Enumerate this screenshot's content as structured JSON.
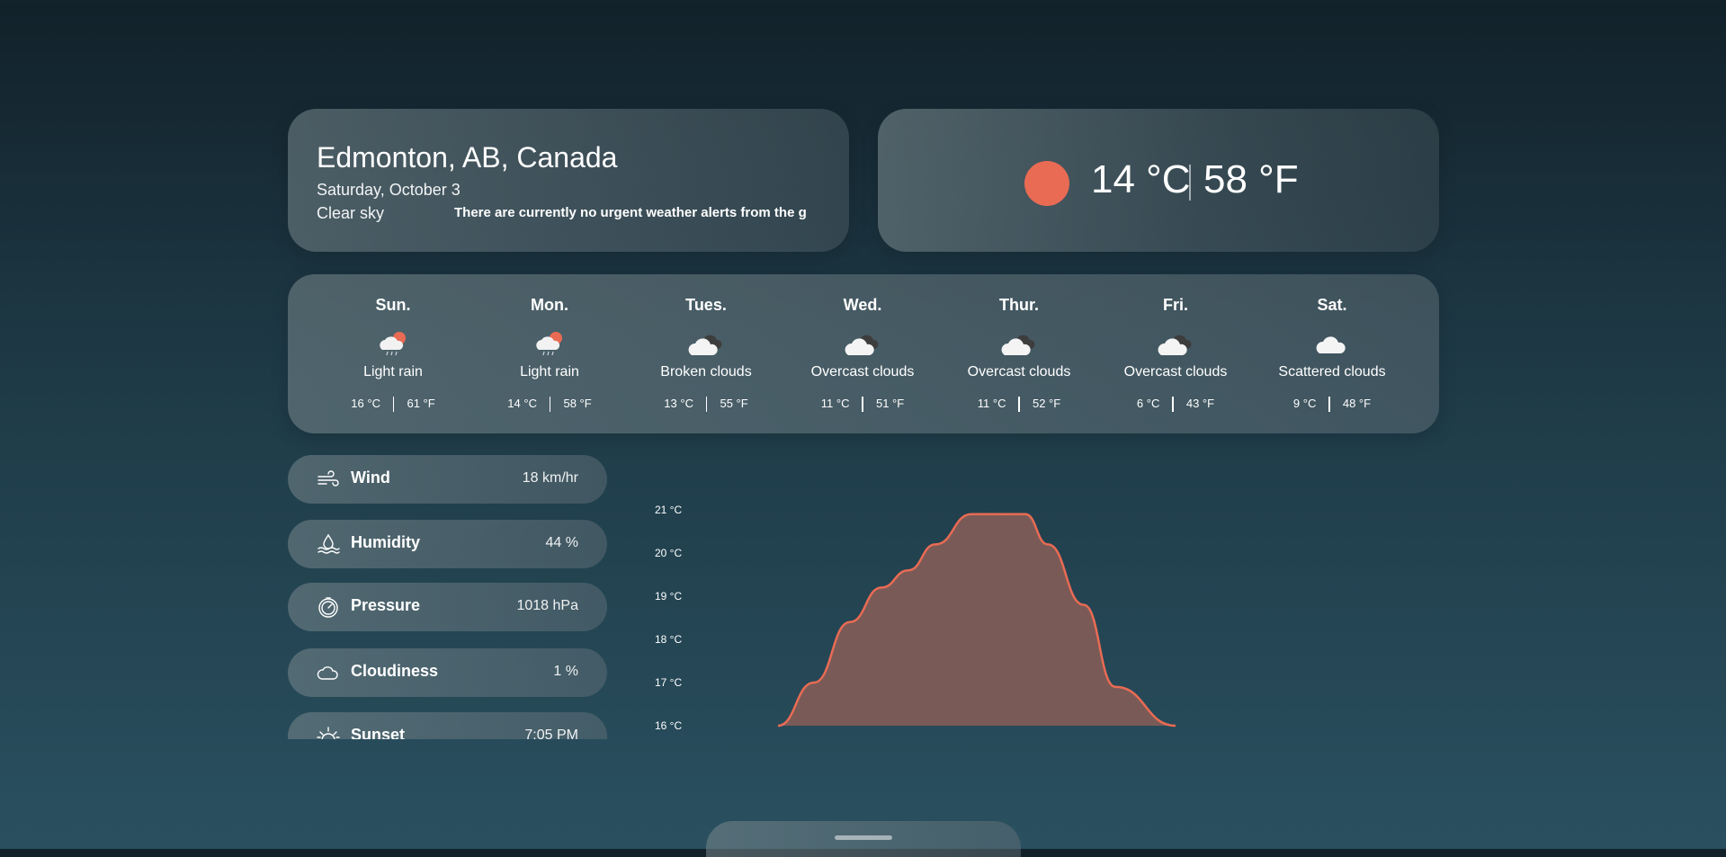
{
  "location": {
    "city": "Edmonton, AB, Canada",
    "date": "Saturday, October 3",
    "description": "Clear sky",
    "alert": "There are currently no urgent weather alerts from the gc"
  },
  "current": {
    "temp_c": "14 °C",
    "temp_f": "58 °F",
    "icon": "sun-icon",
    "icon_color": "#e96b54"
  },
  "forecast": [
    {
      "day": "Sun.",
      "icon": "cloud-rain-sun-icon",
      "desc": "Light rain",
      "temp_c": "16 °C",
      "temp_f": "61 °F"
    },
    {
      "day": "Mon.",
      "icon": "cloud-rain-sun-icon",
      "desc": "Light rain",
      "temp_c": "14 °C",
      "temp_f": "58 °F"
    },
    {
      "day": "Tues.",
      "icon": "broken-clouds-icon",
      "desc": "Broken clouds",
      "temp_c": "13 °C",
      "temp_f": "55 °F"
    },
    {
      "day": "Wed.",
      "icon": "overcast-clouds-icon",
      "desc": "Overcast clouds",
      "temp_c": "11 °C",
      "temp_f": "51 °F"
    },
    {
      "day": "Thur.",
      "icon": "overcast-clouds-icon",
      "desc": "Overcast clouds",
      "temp_c": "11 °C",
      "temp_f": "52 °F"
    },
    {
      "day": "Fri.",
      "icon": "overcast-clouds-icon",
      "desc": "Overcast clouds",
      "temp_c": "6 °C",
      "temp_f": "43 °F"
    },
    {
      "day": "Sat.",
      "icon": "scattered-clouds-icon",
      "desc": "Scattered clouds",
      "temp_c": "9 °C",
      "temp_f": "48 °F"
    }
  ],
  "stats": [
    {
      "label": "Wind",
      "value": "18 km/hr",
      "icon": "wind-icon"
    },
    {
      "label": "Humidity",
      "value": "44 %",
      "icon": "humidity-icon"
    },
    {
      "label": "Pressure",
      "value": "1018 hPa",
      "icon": "pressure-gauge-icon"
    },
    {
      "label": "Cloudiness",
      "value": "1 %",
      "icon": "cloud-icon"
    },
    {
      "label": "Sunset",
      "value": "7:05 PM",
      "icon": "sunset-icon"
    }
  ],
  "chart_data": {
    "type": "area",
    "ytick_labels": [
      "21 °C",
      "20 °C",
      "19 °C",
      "18 °C",
      "17 °C",
      "16 °C"
    ],
    "ylim": [
      16,
      21
    ],
    "series": [
      {
        "values": [
          16,
          17,
          18.4,
          19.2,
          19.6,
          20.2,
          20.9,
          20.9,
          20.9,
          20.2,
          18.8,
          16.9,
          16
        ]
      }
    ],
    "fill_color": "#7a5a56",
    "line_color": "#e96b54"
  }
}
